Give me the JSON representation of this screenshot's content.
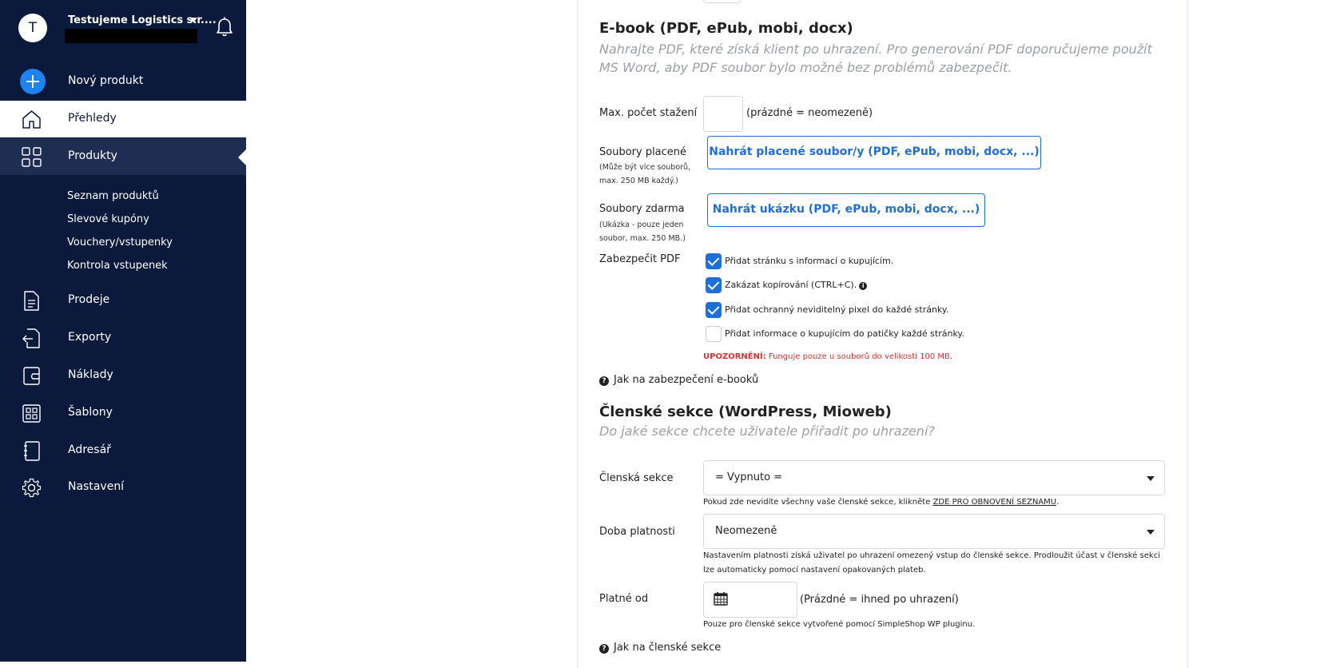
{
  "account": {
    "avatar_letter": "T",
    "name": "Testujeme Logistics s.r...."
  },
  "sidebar": {
    "new_product": "Nový produkt",
    "items": [
      {
        "label": "Přehledy",
        "icon": "home-icon"
      },
      {
        "label": "Produkty",
        "icon": "grid-icon"
      },
      {
        "label": "Prodeje",
        "icon": "document-icon"
      },
      {
        "label": "Exporty",
        "icon": "export-icon"
      },
      {
        "label": "Náklady",
        "icon": "wallet-icon"
      },
      {
        "label": "Šablony",
        "icon": "template-icon"
      },
      {
        "label": "Adresář",
        "icon": "address-book-icon"
      },
      {
        "label": "Nastavení",
        "icon": "gear-icon"
      }
    ],
    "submenu": [
      "Seznam produktů",
      "Slevové kupóny",
      "Vouchery/vstupenky",
      "Kontrola vstupenek"
    ]
  },
  "ebook": {
    "title": "E-book (PDF, ePub, mobi, docx)",
    "lead": "Nahrajte PDF, které získá klient po uhrazení. Pro generování PDF doporučujeme použít MS Word, aby PDF soubor bylo možné bez problémů zabezpečit.",
    "max_downloads_label": "Max. počet stažení",
    "max_downloads_value": "",
    "max_downloads_hint": "(prázdné = neomezeně)",
    "paid_files_label": "Soubory placené",
    "paid_files_note": "(Může být více souborů, max. 250 MB každý.)",
    "paid_files_button": "Nahrát placené soubor/y (PDF, ePub, mobi, docx, ...)",
    "free_files_label": "Soubory zdarma",
    "free_files_note": "(Ukázka - pouze jeden soubor, max. 250 MB.)",
    "free_files_button": "Nahrát ukázku (PDF, ePub, mobi, docx, ...)",
    "secure_label": "Zabezpečit PDF",
    "options": [
      {
        "label": "Přidat stránku s informací o kupujícím.",
        "checked": true
      },
      {
        "label": "Zakázat kopírování (CTRL+C).",
        "checked": true
      },
      {
        "label": "Přidat ochranný neviditelný pixel do každé stránky.",
        "checked": true
      },
      {
        "label": "Přidat informace o kupujícím do patičky každé stránky.",
        "checked": false
      }
    ],
    "warning_strong": "UPOZORNĚNÍ:",
    "warning_text": "Funguje pouze u souborů do velikosti 100 MB.",
    "help_link": "Jak na zabezpečení e-booků"
  },
  "members": {
    "title": "Členské sekce (WordPress, Mioweb)",
    "lead": "Do jaké sekce chcete uživatele přiřadit po uhrazení?",
    "section_label": "Členská sekce",
    "section_value": "= Vypnuto =",
    "section_note_pre": "Pokud zde nevidíte všechny vaše členské sekce, klikněte",
    "section_note_link": "ZDE PRO OBNOVENÍ SEZNAMU",
    "validity_label": "Doba platnosti",
    "validity_value": "Neomezeně",
    "validity_note": "Nastavením platnosti získá uživatel po uhrazení omezený vstup do členské sekce. Prodloužit účast v členské sekci lze automaticky pomocí nastavení opakovaných plateb.",
    "valid_from_label": "Platné od",
    "valid_from_hint": "(Prázdné = ihned po uhrazení)",
    "valid_from_note": "Pouze pro členské sekce vytvořené pomocí SimpleShop WP pluginu.",
    "help_link": "Jak na členské sekce"
  }
}
